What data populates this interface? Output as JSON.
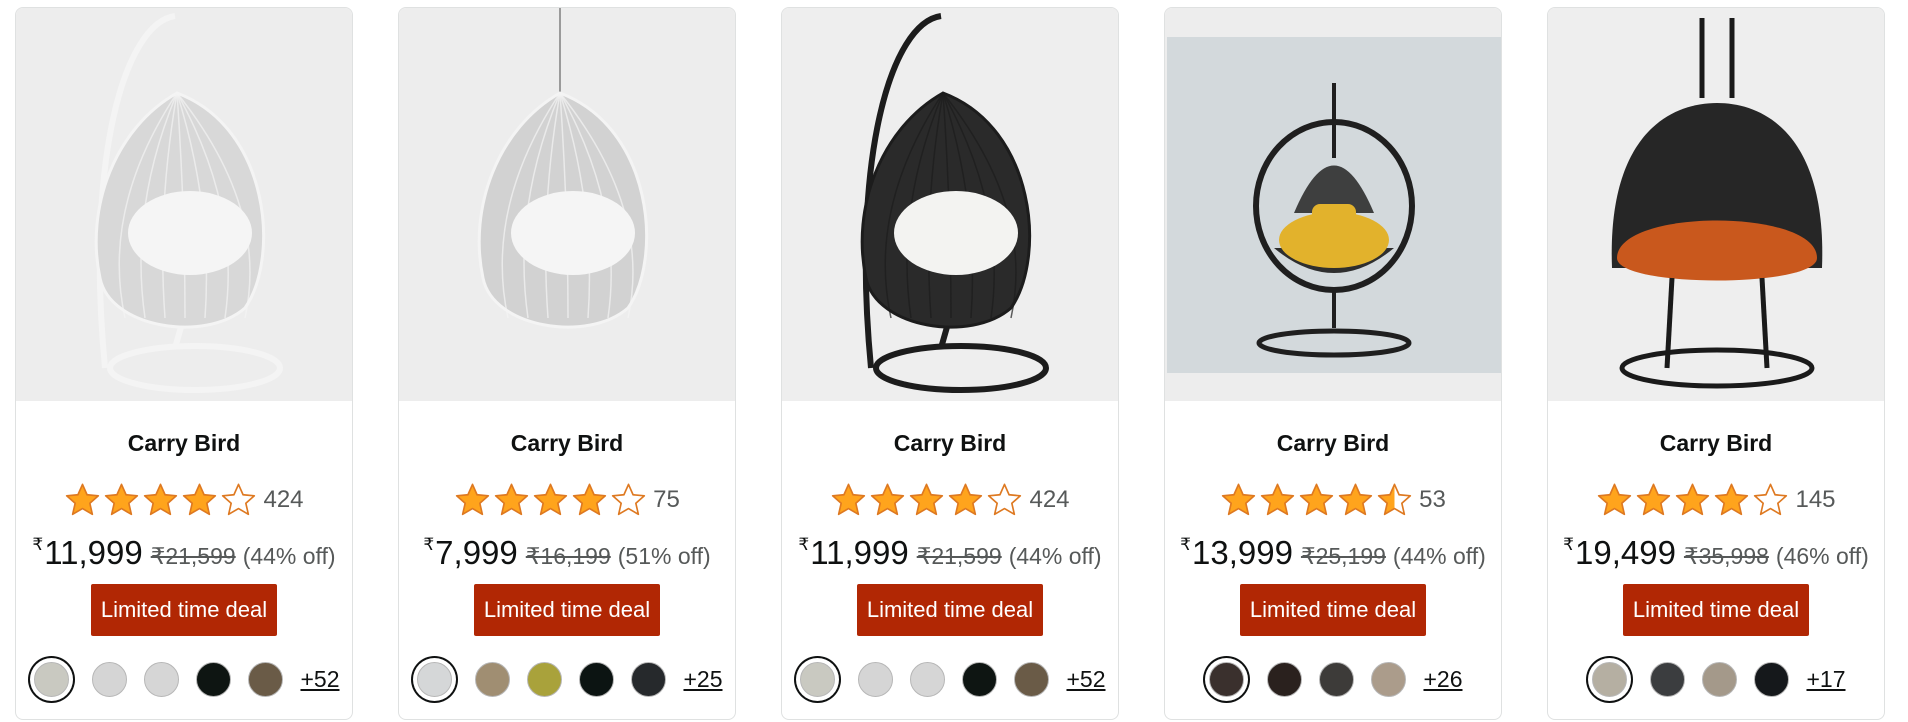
{
  "products": [
    {
      "brand": "Carry Bird",
      "image": {
        "description": "white-wicker-egg-swing-chair-with-stand",
        "bg": "#ededed",
        "frame": "#f4f4f4",
        "weave": "#d8d8d8",
        "cushion": "#f5f5f5",
        "stand": true,
        "square_photo": false,
        "double_seat": false,
        "open_ring": false
      },
      "rating": 3.9,
      "review_count": "424",
      "currency": "₹",
      "price": "11,999",
      "mrp": "₹21,599",
      "discount": "(44% off)",
      "deal_label": "Limited time deal",
      "swatches": [
        "#c9c9c1",
        "#d5d5d5",
        "#d6d6d6",
        "#0e1512",
        "#6a5b47"
      ],
      "more_swatches": "+52"
    },
    {
      "brand": "Carry Bird",
      "image": {
        "description": "white-hanging-egg-chair-without-stand",
        "bg": "#ededed",
        "frame": "#f4f4f4",
        "weave": "#d2d2d2",
        "cushion": "#f5f5f5",
        "stand": false,
        "square_photo": false,
        "double_seat": false,
        "open_ring": false
      },
      "rating": 3.8,
      "review_count": "75",
      "currency": "₹",
      "price": "7,999",
      "mrp": "₹16,199",
      "discount": "(51% off)",
      "deal_label": "Limited time deal",
      "swatches": [
        "#d5d7d8",
        "#a08e72",
        "#a9a23b",
        "#0c1412",
        "#26292c"
      ],
      "more_swatches": "+25"
    },
    {
      "brand": "Carry Bird",
      "image": {
        "description": "black-wicker-egg-swing-with-white-cushion",
        "bg": "#eeeeee",
        "frame": "#1c1c1c",
        "weave": "#2a2a2a",
        "cushion": "#f3f3f1",
        "stand": true,
        "square_photo": false,
        "double_seat": false,
        "open_ring": false
      },
      "rating": 3.8,
      "review_count": "424",
      "currency": "₹",
      "price": "11,999",
      "mrp": "₹21,599",
      "discount": "(44% off)",
      "deal_label": "Limited time deal",
      "swatches": [
        "#c9c9c1",
        "#d5d5d5",
        "#d6d6d6",
        "#0e1512",
        "#6a5b47"
      ],
      "more_swatches": "+52"
    },
    {
      "brand": "Carry Bird",
      "image": {
        "description": "black-ring-swing-with-yellow-cushion",
        "bg": "#d3d9dc",
        "frame": "#1f1f1f",
        "weave": "#2e2e2e",
        "cushion": "#e2b22c",
        "stand": true,
        "square_photo": true,
        "double_seat": false,
        "open_ring": true
      },
      "rating": 4.4,
      "review_count": "53",
      "currency": "₹",
      "price": "13,999",
      "mrp": "₹25,199",
      "discount": "(44% off)",
      "deal_label": "Limited time deal",
      "swatches": [
        "#3a302d",
        "#2a211e",
        "#3d3b39",
        "#ab9c8b"
      ],
      "more_swatches": "+26"
    },
    {
      "brand": "Carry Bird",
      "image": {
        "description": "black-double-seat-swing-with-orange-cushion",
        "bg": "#eeeeee",
        "frame": "#1a1a1a",
        "weave": "#262626",
        "cushion": "#c9581d",
        "stand": true,
        "square_photo": false,
        "double_seat": true,
        "open_ring": false
      },
      "rating": 3.9,
      "review_count": "145",
      "currency": "₹",
      "price": "19,499",
      "mrp": "₹35,998",
      "discount": "(46% off)",
      "deal_label": "Limited time deal",
      "swatches": [
        "#b5afa2",
        "#3b3d3f",
        "#a4998a",
        "#15181b"
      ],
      "more_swatches": "+17"
    }
  ],
  "colors": {
    "deal_badge": "#b12704",
    "star_fill": "#ffa41c",
    "star_outline": "#de7921",
    "muted_text": "#565959"
  },
  "icons": {
    "star": "star-icon",
    "half_star": "half-star-icon",
    "empty_star": "empty-star-icon"
  }
}
